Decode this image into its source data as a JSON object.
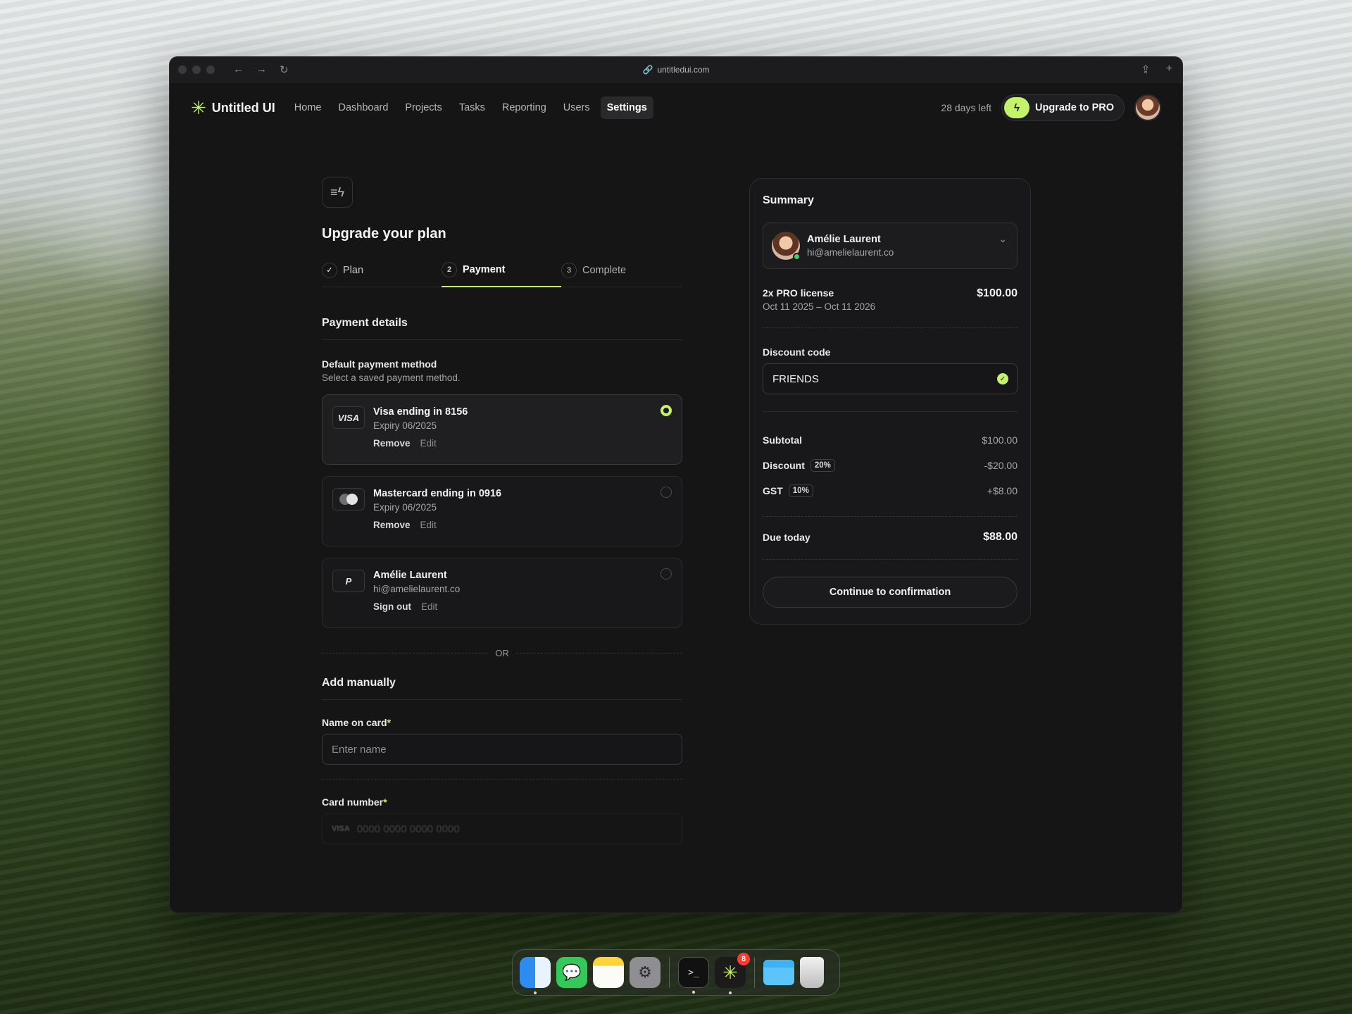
{
  "browser": {
    "url": "untitledui.com"
  },
  "header": {
    "logo": "Untitled UI",
    "nav": [
      "Home",
      "Dashboard",
      "Projects",
      "Tasks",
      "Reporting",
      "Users",
      "Settings"
    ],
    "active_nav": "Settings",
    "days_left": "28 days left",
    "upgrade_label": "Upgrade to PRO"
  },
  "main": {
    "title": "Upgrade your plan",
    "steps": [
      {
        "num": "✓",
        "label": "Plan"
      },
      {
        "num": "2",
        "label": "Payment"
      },
      {
        "num": "3",
        "label": "Complete"
      }
    ],
    "payment_details_title": "Payment details",
    "default_method_title": "Default payment method",
    "default_method_sub": "Select a saved payment method.",
    "methods": [
      {
        "logo": "VISA",
        "title": "Visa ending in 8156",
        "sub": "Expiry 06/2025",
        "primary_action": "Remove",
        "secondary_action": "Edit",
        "selected": true
      },
      {
        "logo": "mastercard-icon",
        "title": "Mastercard ending in 0916",
        "sub": "Expiry 06/2025",
        "primary_action": "Remove",
        "secondary_action": "Edit",
        "selected": false
      },
      {
        "logo": "paypal-icon",
        "title": "Amélie Laurent",
        "sub": "hi@amelielaurent.co",
        "primary_action": "Sign out",
        "secondary_action": "Edit",
        "selected": false
      }
    ],
    "or_label": "OR",
    "add_manually_title": "Add manually",
    "name_label": "Name on card",
    "required_mark": "*",
    "name_placeholder": "Enter name",
    "card_number_label": "Card number",
    "card_number_placeholder": "0000 0000 0000 0000",
    "card_number_logo": "VISA"
  },
  "summary": {
    "title": "Summary",
    "user_name": "Amélie Laurent",
    "user_email": "hi@amelielaurent.co",
    "license_title": "2x PRO license",
    "license_dates": "Oct 11 2025 – Oct 11 2026",
    "license_price": "$100.00",
    "discount_label": "Discount code",
    "discount_value": "FRIENDS",
    "subtotal_label": "Subtotal",
    "subtotal_value": "$100.00",
    "discount_row_label": "Discount",
    "discount_badge": "20%",
    "discount_row_value": "-$20.00",
    "gst_label": "GST",
    "gst_badge": "10%",
    "gst_value": "+$8.00",
    "due_label": "Due today",
    "due_value": "$88.00",
    "cta": "Continue to confirmation"
  },
  "dock": {
    "apps": [
      "finder-icon",
      "messages-icon",
      "notes-icon",
      "settings-icon",
      "terminal-icon",
      "untitled-ui-icon",
      "folder-icon",
      "trash-icon"
    ],
    "untitled_badge": "8",
    "terminal_glyph": ">_"
  },
  "colors": {
    "accent": "#c5f26b",
    "window_bg": "#151516",
    "success_dot": "#3ecf6e"
  }
}
